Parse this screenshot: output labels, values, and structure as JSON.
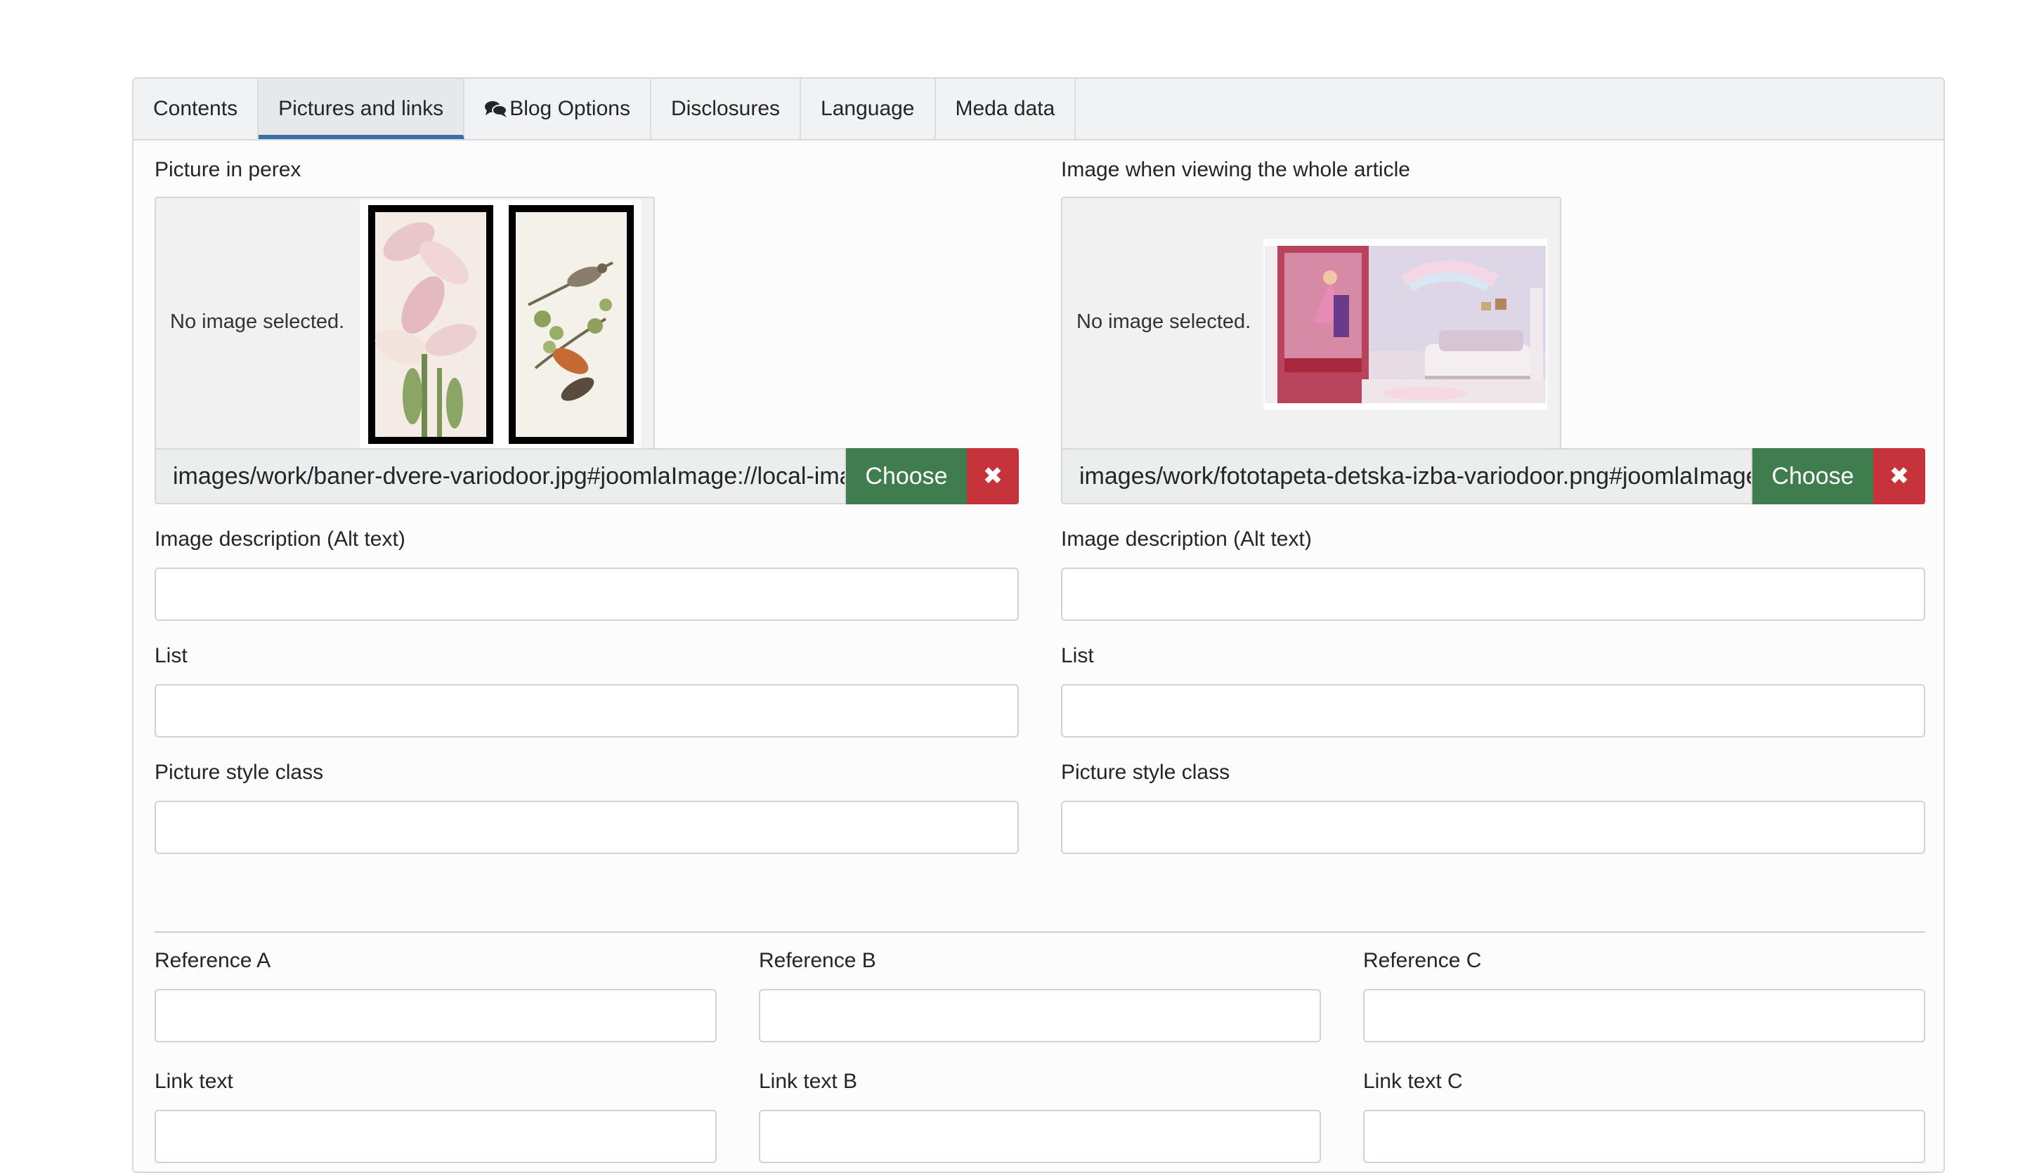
{
  "tabs": [
    {
      "label": "Contents"
    },
    {
      "label": "Pictures and links",
      "active": true
    },
    {
      "label": "Blog Options",
      "icon": "comments-icon"
    },
    {
      "label": "Disclosures"
    },
    {
      "label": "Language"
    },
    {
      "label": "Meda data"
    }
  ],
  "intro_image": {
    "label": "Picture in perex",
    "no_image_text": "No image selected.",
    "path": "images/work/baner-dvere-variodoor.jpg#joomlaImage://local-images/work/baner-dvere-variodoor.jpg",
    "choose_label": "Choose",
    "clear_label": "✖",
    "alt_label": "Image description (Alt text)",
    "list_label": "List",
    "class_label": "Picture style class"
  },
  "full_image": {
    "label": "Image when viewing the whole article",
    "no_image_text": "No image selected.",
    "path": "images/work/fototapeta-detska-izba-variodoor.png#joomlaImage://local-images/work/fototapeta-detska-izba-variodoor.png",
    "choose_label": "Choose",
    "clear_label": "✖",
    "alt_label": "Image description (Alt text)",
    "list_label": "List",
    "class_label": "Picture style class"
  },
  "links": {
    "a": {
      "label": "Reference A",
      "text_label": "Link text"
    },
    "b": {
      "label": "Reference B",
      "text_label": "Link text B"
    },
    "c": {
      "label": "Reference C",
      "text_label": "Link text C"
    }
  },
  "colors": {
    "choose": "#3f7d4e",
    "clear": "#c7333a",
    "active_tab_underline": "#3b6ea5"
  }
}
